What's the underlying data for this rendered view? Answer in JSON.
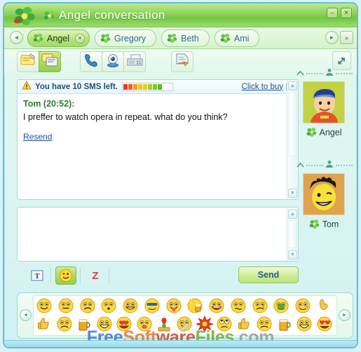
{
  "window": {
    "title": "Angel conversation",
    "logo_icon": "icq-flower-icon",
    "title_flower_icon": "flower-icon",
    "minimize_label": "–",
    "close_label": "✕"
  },
  "tabs": {
    "prev_label": "◄",
    "next_label": "►",
    "more_label": "»",
    "items": [
      {
        "label": "Angel",
        "icon": "flower-icon",
        "active": true,
        "close_label": "✕"
      },
      {
        "label": "Gregory",
        "icon": "flower-icon",
        "active": false,
        "close_label": ""
      },
      {
        "label": "Beth",
        "icon": "flower-icon",
        "active": false,
        "close_label": ""
      },
      {
        "label": "Ami",
        "icon": "flower-icon",
        "active": false,
        "close_label": ""
      }
    ]
  },
  "toolbar": {
    "buttons": [
      {
        "name": "send-message-button",
        "icon": "note-icon",
        "selected": false
      },
      {
        "name": "send-sms-button",
        "icon": "sms-icon",
        "selected": true
      },
      {
        "name": "voice-call-button",
        "icon": "phone-icon",
        "selected": false
      },
      {
        "name": "video-call-button",
        "icon": "webcam-icon",
        "selected": false
      },
      {
        "name": "phone-button",
        "icon": "fax-icon",
        "selected": false
      },
      {
        "name": "send-file-button",
        "icon": "file-send-icon",
        "selected": false
      }
    ],
    "popout_icon": "expand-arrow-icon"
  },
  "sms_notice": {
    "warning_icon": "warning-icon",
    "text": "You have 10 SMS left.",
    "remaining": 10,
    "meter_total": 10,
    "meter_filled": 8,
    "meter_colors": [
      "#e23b28",
      "#ef5f25",
      "#f59a1e",
      "#f6c01c",
      "#d8d41a",
      "#a8cf1c",
      "#7ec81e",
      "#55bf21",
      "#ffffff",
      "#ffffff"
    ],
    "buy_link": "Click to buy",
    "close_label": "✕"
  },
  "history": {
    "scroll_up_label": "▲",
    "scroll_down_label": "▼",
    "messages": [
      {
        "sender": "Tom",
        "time": "20:52",
        "header": "Tom (20:52):",
        "body": "I preffer to watch opera in repeat. what do you think?",
        "action_label": "Resend"
      }
    ]
  },
  "composer": {
    "value": "",
    "placeholder": "",
    "scroll_up_label": "▲",
    "scroll_down_label": "▼"
  },
  "controls": {
    "font_label": "T",
    "font_icon": "font-icon",
    "smiley_icon": "smiley-icon",
    "xtraz_label": "Z",
    "xtraz_icon": "xtraz-icon",
    "send_label": "Send"
  },
  "sidebar": {
    "contacts": [
      {
        "name": "Angel",
        "icon": "flower-icon",
        "collapse_icon": "chevron-up-icon",
        "person_icon": "person-icon",
        "avatar": "angel-avatar"
      },
      {
        "name": "Tom",
        "icon": "flower-icon",
        "collapse_icon": "chevron-up-icon",
        "person_icon": "person-icon",
        "avatar": "tom-avatar"
      }
    ]
  },
  "emoticons": {
    "prev_label": "◄",
    "next_label": "►",
    "rows": [
      [
        "smile",
        "neutral",
        "sad",
        "surprised",
        "grin",
        "cool",
        "tongue",
        "beer-toast",
        "laugh",
        "confused",
        "cry",
        "sick",
        "blush",
        "wave"
      ],
      [
        "thumbs-up",
        "worried",
        "beer",
        "big-grin",
        "in-love",
        "kiss",
        "rose",
        "band-aid",
        "explosion",
        "rolling-eyes",
        "thumbs-up-2",
        "frown",
        "beer-2",
        "happy",
        "heart-eyes"
      ]
    ]
  },
  "watermark": {
    "part1": "Free",
    "part2": "Soft",
    "part3": "ware",
    "part4": "Files",
    "part5": ".com"
  },
  "colors": {
    "accent_green": "#8fd45e",
    "frame_blue": "#5ec3d6",
    "link_blue": "#1b4f9b",
    "sender_green": "#2f7d2f"
  }
}
